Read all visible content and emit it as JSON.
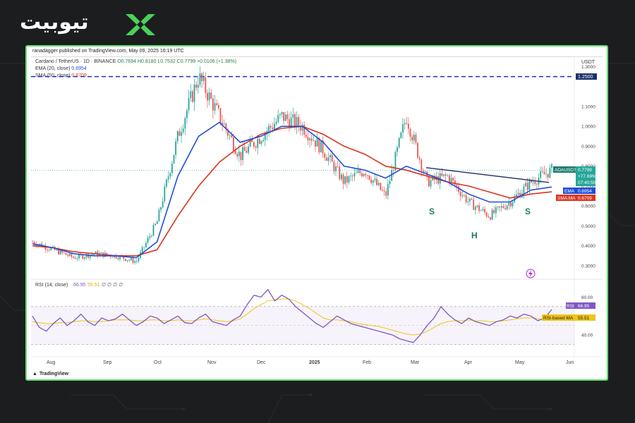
{
  "logo": {
    "text": "تیوبیت",
    "mark": "green-x-logo"
  },
  "header": {
    "author_line": "ranadagger published on TradingView.com, May 09, 2025 16:19 UTC"
  },
  "legend": {
    "symbol": "Cardano / TetherUS · 1D · BINANCE",
    "ohlc": "O0.7694 H0.8180 L0.7532 C0.7799 +0.0106 (+1.38%)",
    "ema_label": "EMA (20, close)",
    "ema_value": "0.6954",
    "sma_label": "SMA (50, close)",
    "sma_value": "0.6709",
    "rsi_label": "RSI (14, close)",
    "rsi_value": "66.95",
    "rsi_ma_value": "55.51",
    "rsi_extra": "∅ ∅ ∅ ∅"
  },
  "price_axis": {
    "currency": "USDT",
    "ticks": [
      "1.3000",
      "1.2500",
      "1.1000",
      "1.0000",
      "0.9000",
      "0.8000",
      "0.7000",
      "0.6000",
      "0.5000",
      "0.4000",
      "0.3000"
    ],
    "tags": {
      "resistance": "1.2500",
      "symbol": "ADAUSDT",
      "last": "0.7799",
      "change": "+77.69%",
      "countdown": "07:40:50",
      "ema": "EMA",
      "ema_val": "0.6954",
      "sma": "SMA:MA",
      "sma_val": "0.6709"
    }
  },
  "rsi_axis": {
    "ticks": [
      "80.00",
      "60.00",
      "40.00"
    ],
    "tags": {
      "rsi": "RSI",
      "rsi_val": "66.95",
      "ma": "RSI-based MA",
      "ma_val": "55.51"
    }
  },
  "time_axis": [
    "Aug",
    "Sep",
    "Oct",
    "Nov",
    "Dec",
    "2025",
    "Feb",
    "Mar",
    "Apr",
    "May",
    "Jun"
  ],
  "annotations": {
    "left_shoulder": "S",
    "head": "H",
    "right_shoulder": "S"
  },
  "footer": {
    "brand": "TradingView"
  },
  "colors": {
    "frame": "#5ee36a",
    "up": "#26a69a",
    "down": "#ef5350",
    "ema": "#1e50d8",
    "sma": "#d9361e",
    "neckline": "#1a2f66",
    "resistance": "#1a2fd0",
    "rsi": "#7e57c2",
    "rsi_ma": "#f0c419"
  },
  "chart_data": {
    "type": "line",
    "title": "Cardano / TetherUS · 1D · BINANCE",
    "x": [
      "2025-07-20",
      "2025-08-01",
      "2025-09-01",
      "2025-10-01",
      "2025-11-01",
      "2025-11-10",
      "2025-11-20",
      "2025-12-01",
      "2025-12-03",
      "2025-12-10",
      "2025-12-20",
      "2025-01-01",
      "2025-01-10",
      "2025-01-20",
      "2025-02-01",
      "2025-02-03",
      "2025-02-15",
      "2025-03-01",
      "2025-03-03",
      "2025-03-10",
      "2025-03-20",
      "2025-04-01",
      "2025-04-07",
      "2025-04-20",
      "2025-05-01",
      "2025-05-09"
    ],
    "series": [
      {
        "name": "ADAUSDT",
        "values": [
          0.42,
          0.38,
          0.34,
          0.36,
          0.35,
          0.32,
          0.52,
          0.95,
          1.25,
          1.05,
          0.85,
          0.95,
          1.05,
          1.0,
          0.88,
          0.72,
          0.78,
          0.65,
          1.05,
          0.72,
          0.75,
          0.62,
          0.55,
          0.62,
          0.72,
          0.7799
        ]
      },
      {
        "name": "EMA",
        "values": [
          0.41,
          0.39,
          0.36,
          0.35,
          0.35,
          0.34,
          0.42,
          0.75,
          0.95,
          1.02,
          0.92,
          0.95,
          1.0,
          1.0,
          0.92,
          0.8,
          0.78,
          0.74,
          0.8,
          0.76,
          0.72,
          0.66,
          0.62,
          0.62,
          0.68,
          0.6954
        ]
      },
      {
        "name": "SMA:MA",
        "values": [
          0.4,
          0.39,
          0.37,
          0.36,
          0.35,
          0.35,
          0.38,
          0.55,
          0.7,
          0.82,
          0.9,
          0.96,
          0.99,
          1.0,
          0.96,
          0.9,
          0.86,
          0.8,
          0.78,
          0.75,
          0.72,
          0.7,
          0.67,
          0.64,
          0.66,
          0.6709
        ]
      }
    ],
    "neckline": {
      "x": [
        "2025-03-05",
        "2025-05-12"
      ],
      "y": [
        0.7925,
        0.718
      ]
    },
    "resistance": 1.25,
    "ylim": [
      0.25,
      1.33
    ],
    "rsi": {
      "name": "RSI",
      "values": [
        60,
        48,
        44,
        52,
        58,
        50,
        55,
        62,
        54,
        50,
        58,
        55,
        57,
        62,
        56,
        50,
        54,
        60,
        58,
        52,
        56,
        60,
        53,
        52,
        58,
        62,
        54,
        52,
        50,
        56,
        60,
        72,
        82,
        80,
        88,
        76,
        82,
        78,
        70,
        64,
        58,
        52,
        48,
        54,
        60,
        56,
        52,
        50,
        48,
        46,
        44,
        42,
        40,
        36,
        34,
        32,
        40,
        50,
        58,
        70,
        62,
        56,
        52,
        58,
        54,
        52,
        50,
        54,
        56,
        60,
        58,
        62,
        60,
        55,
        58,
        66.95
      ],
      "ma_values": [
        54,
        53,
        52,
        52,
        53,
        53,
        54,
        55,
        55,
        54,
        54,
        55,
        56,
        56,
        56,
        55,
        55,
        56,
        56,
        55,
        55,
        56,
        55,
        55,
        56,
        57,
        56,
        55,
        54,
        55,
        57,
        62,
        68,
        72,
        76,
        77,
        78,
        78,
        76,
        72,
        68,
        63,
        58,
        56,
        56,
        55,
        54,
        52,
        51,
        50,
        49,
        47,
        45,
        43,
        41,
        40,
        41,
        44,
        48,
        52,
        54,
        55,
        55,
        56,
        55,
        55,
        54,
        54,
        55,
        56,
        57,
        58,
        58,
        57,
        56,
        55.51
      ],
      "ylim": [
        20,
        90
      ]
    }
  }
}
